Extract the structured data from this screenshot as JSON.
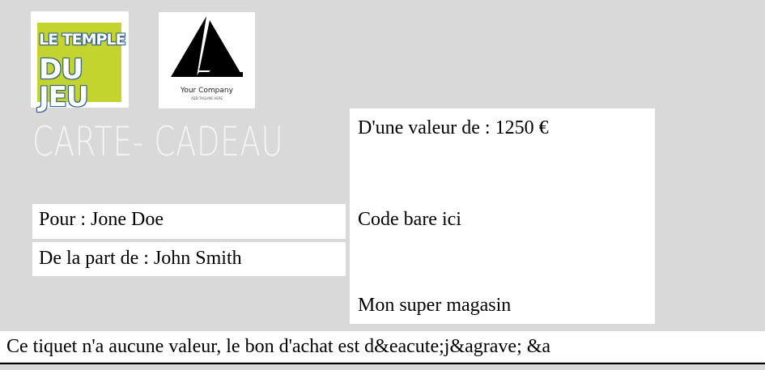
{
  "logos": {
    "temple_du_jeu": {
      "line1": "LE TEMPLE",
      "line2": "DU JEU",
      "colors": {
        "bg": "#c3d42f",
        "outline": "#2f5d86"
      }
    },
    "your_company": {
      "name": "Your Company",
      "tagline": "ADD TAGLINE HERE"
    }
  },
  "card": {
    "title": "CARTE- CADEAU",
    "pour": "Pour : Jone Doe",
    "de_la_part": "De la part de : John Smith",
    "valeur": "D'une valeur de : 1250 €",
    "code_bare": "Code bare ici",
    "magasin": "Mon super magasin"
  },
  "footer": {
    "notice": "Ce tiquet n'a aucune valeur, le bon d'achat est d&eacute;j&agrave; &a"
  },
  "colors": {
    "background": "#d9d9d9",
    "panel": "#ffffff"
  }
}
